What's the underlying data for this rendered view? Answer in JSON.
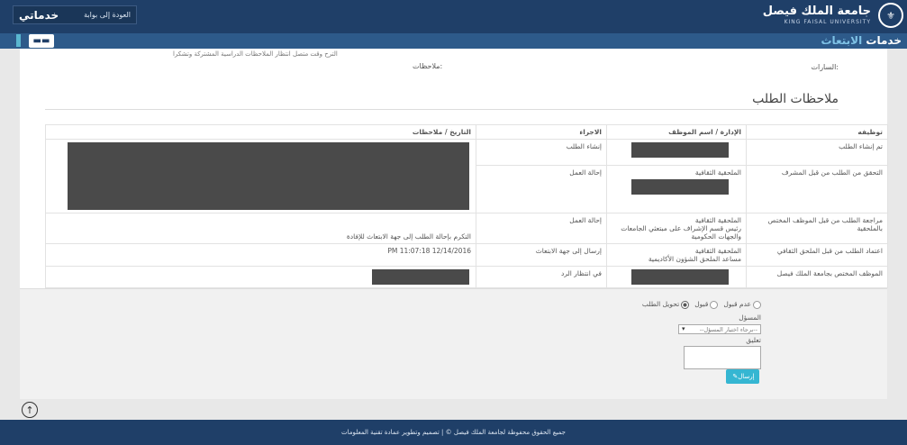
{
  "header": {
    "university_name": "جامعة الملك فيصل",
    "university_name_en": "KING FAISAL UNIVERSITY",
    "back_to_portal": "العودة إلى بوابة",
    "portal_brand": "خدماتي"
  },
  "subheader": {
    "services_title_main": "خدمات",
    "services_title_accent": "الابتعاث"
  },
  "top_section": {
    "partial_text": "الترح وقت متصل انتظار الملاحظات الدراسية المشتركة وتشكرا",
    "notes_label": "ملاحظات:",
    "status_label": "السارات:"
  },
  "notes_section": {
    "title": "ملاحظات الطلب",
    "columns": [
      "توظيفه",
      "الإدارة / اسم الموظف",
      "الاجراء",
      "التاريخ / ملاحظات"
    ],
    "rows": [
      {
        "step": "تم إنشاء الطلب",
        "dept": "",
        "action": "إنشاء الطلب",
        "note": ""
      },
      {
        "step": "التحقق من الطلب من قبل المشرف",
        "dept": "الملحقية الثقافية",
        "action": "إحالة العمل",
        "note": ""
      },
      {
        "step": "مراجعة الطلب من قبل الموظف المختص بالملحقية",
        "dept": "الملحقية الثقافية",
        "dept_sub": "رئيس قسم الإشراف على مبتعثي الجامعات والجهات الحكومية",
        "action": "إحالة العمل",
        "note": "التكرم بإحالة الطلب إلى جهة الابتعاث للإفادة"
      },
      {
        "step": "اعتماد الطلب من قبل الملحق الثقافي",
        "dept": "الملحقية الثقافية",
        "dept_sub": "مساعد الملحق الشؤون الأكاديمية",
        "action": "إرسال إلى جهة الابتعاث",
        "note": "PM 11:07:18 12/14/2016"
      },
      {
        "step": "الموظف المختص بجامعة الملك فيصل",
        "dept": "",
        "action": "في انتظار الرد",
        "note": ""
      }
    ]
  },
  "form": {
    "radio_options": [
      "عدم قبول",
      "قبول",
      "تحويل الطلب"
    ],
    "selected_option": "تحويل الطلب",
    "responsible_label": "المسؤل",
    "responsible_placeholder": "--برجاء اختيار المسؤل--",
    "comment_label": "تعليق",
    "send_label": "إرسال"
  },
  "footer": {
    "text": "جميع الحقوق محفوظة لجامعة الملك فيصل © | تصميم وتطوير عمادة تقنية المعلومات"
  }
}
